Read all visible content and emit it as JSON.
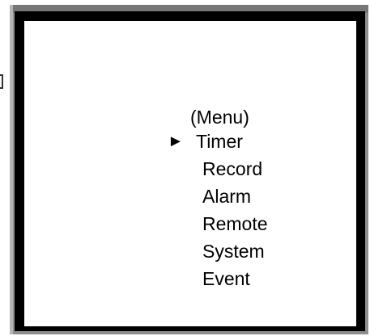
{
  "menu": {
    "title": "(Menu)",
    "cursor": "►",
    "items": [
      {
        "label": "Timer",
        "selected": true
      },
      {
        "label": "Record",
        "selected": false
      },
      {
        "label": "Alarm",
        "selected": false
      },
      {
        "label": "Remote",
        "selected": false
      },
      {
        "label": "System",
        "selected": false
      },
      {
        "label": "Event",
        "selected": false
      }
    ]
  }
}
